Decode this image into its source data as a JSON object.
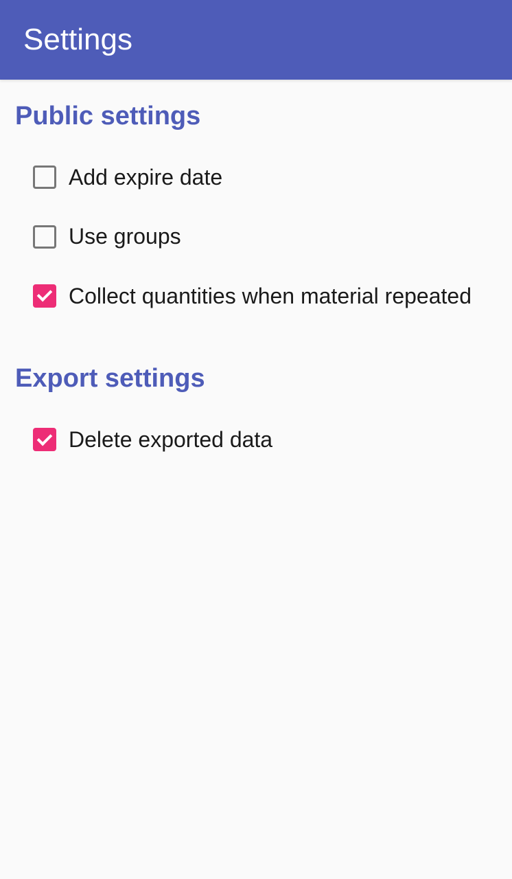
{
  "header": {
    "title": "Settings"
  },
  "sections": {
    "public": {
      "title": "Public settings",
      "items": [
        {
          "label": "Add expire date",
          "checked": false
        },
        {
          "label": "Use groups",
          "checked": false
        },
        {
          "label": "Collect quantities when material repeated",
          "checked": true
        }
      ]
    },
    "export": {
      "title": "Export settings",
      "items": [
        {
          "label": "Delete exported data",
          "checked": true
        }
      ]
    }
  }
}
